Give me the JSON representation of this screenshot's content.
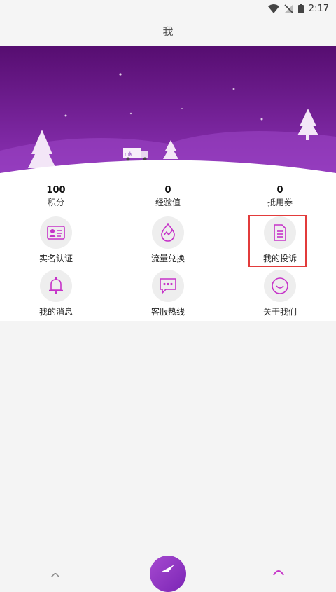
{
  "status_bar": {
    "time": "2:17"
  },
  "header": {
    "title": "我"
  },
  "stats": [
    {
      "value": "100",
      "label": "积分"
    },
    {
      "value": "0",
      "label": "经验值"
    },
    {
      "value": "0",
      "label": "抵用券"
    }
  ],
  "menu": [
    {
      "label": "实名认证",
      "icon": "id-card-icon"
    },
    {
      "label": "流量兑换",
      "icon": "traffic-wave-icon"
    },
    {
      "label": "我的投诉",
      "icon": "document-icon"
    },
    {
      "label": "我的消息",
      "icon": "bell-icon"
    },
    {
      "label": "客服热线",
      "icon": "chat-bubble-icon"
    },
    {
      "label": "关于我们",
      "icon": "smile-icon"
    }
  ],
  "colors": {
    "accent": "#c633c9",
    "banner_top": "#5a0f73",
    "banner_bottom": "#8a2fb3",
    "highlight": "#e23b3b"
  }
}
